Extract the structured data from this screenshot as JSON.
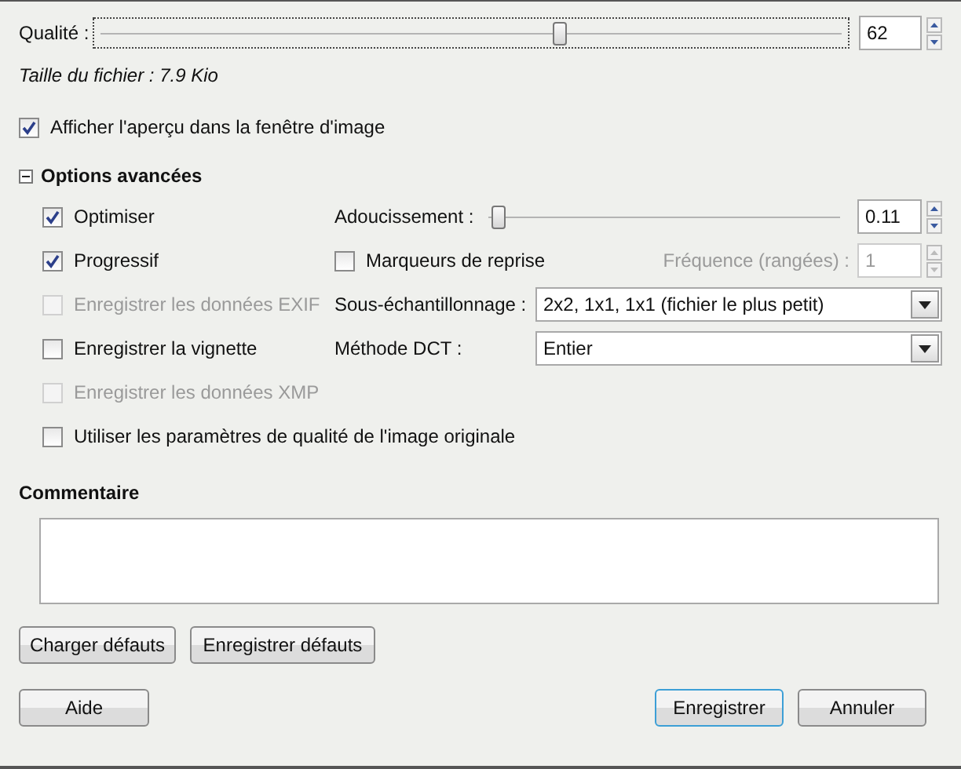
{
  "quality": {
    "label": "Qualité :",
    "level": 0.62,
    "value": "62"
  },
  "file_size": "Taille du fichier : 7.9 Kio",
  "preview": {
    "label": "Afficher l'aperçu dans la fenêtre d'image",
    "checked": true
  },
  "advanced": {
    "label": "Options avancées",
    "expanded": true,
    "rows": [
      {
        "left": {
          "label": "Optimiser",
          "checked": true,
          "disabled": false
        },
        "right": {
          "kind": "slider",
          "label": "Adoucissement :",
          "level": 0.05,
          "value": "0.11"
        }
      },
      {
        "left": {
          "label": "Progressif",
          "checked": true,
          "disabled": false
        },
        "right": {
          "kind": "checkspin",
          "label": "Marqueurs de reprise",
          "checked": false,
          "spin_label": "Fréquence (rangées) :",
          "spin_value": "1",
          "spin_disabled": true
        }
      },
      {
        "left": {
          "label": "Enregistrer les données EXIF",
          "checked": false,
          "disabled": true
        },
        "right": {
          "kind": "select",
          "label": "Sous-échantillonnage :",
          "value": "2x2, 1x1, 1x1 (fichier le plus petit)"
        }
      },
      {
        "left": {
          "label": "Enregistrer la vignette",
          "checked": false,
          "disabled": false
        },
        "right": {
          "kind": "select",
          "label": "Méthode DCT :",
          "value": "Entier"
        }
      },
      {
        "left": {
          "label": "Enregistrer les données XMP",
          "checked": false,
          "disabled": true
        }
      },
      {
        "left": {
          "label": "Utiliser les paramètres de qualité de l'image originale",
          "checked": false,
          "disabled": false
        }
      }
    ]
  },
  "comment": {
    "label": "Commentaire"
  },
  "defaults_buttons": [
    "Charger défauts",
    "Enregistrer défauts"
  ],
  "help_button": "Aide",
  "buttons": [
    {
      "label": "Enregistrer",
      "default": true
    },
    {
      "label": "Annuler",
      "default": false
    }
  ]
}
